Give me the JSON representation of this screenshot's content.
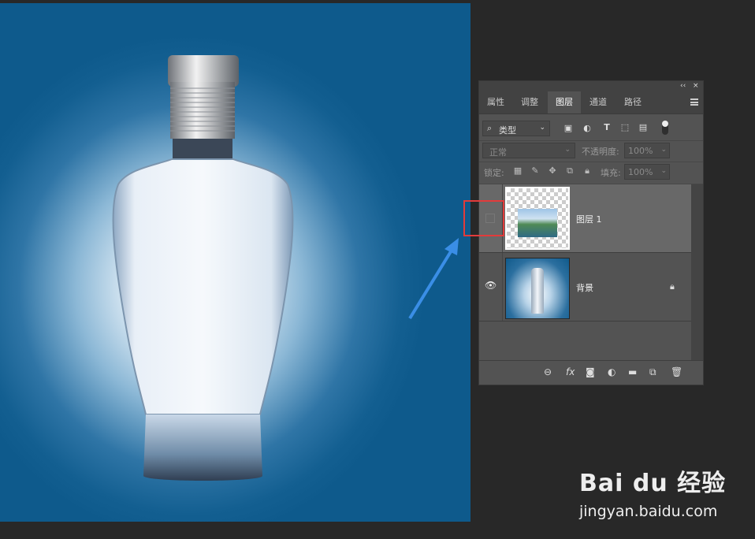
{
  "panel": {
    "tabs": [
      {
        "label": "属性"
      },
      {
        "label": "调整"
      },
      {
        "label": "图层",
        "active": true
      },
      {
        "label": "通道"
      },
      {
        "label": "路径"
      }
    ],
    "collapse_glyph": "‹‹",
    "close_glyph": "×",
    "filter_kind": "类型",
    "blend_mode": "正常",
    "opacity_label": "不透明度:",
    "opacity_value": "100%",
    "lock_label": "锁定:",
    "fill_label": "填充:",
    "fill_value": "100%",
    "layers": [
      {
        "name": "图层 1",
        "visible": false,
        "locked": false
      },
      {
        "name": "背景",
        "visible": true,
        "locked": true
      }
    ],
    "bottom_fx": "fx"
  },
  "watermark": {
    "logo_text": "Bai du 经验",
    "url": "jingyan.baidu.com"
  },
  "colors": {
    "panel_bg": "#535353",
    "highlight": "#e23b3b",
    "arrow": "#3a8ee6",
    "canvas_blue": "#0e5a8c"
  }
}
